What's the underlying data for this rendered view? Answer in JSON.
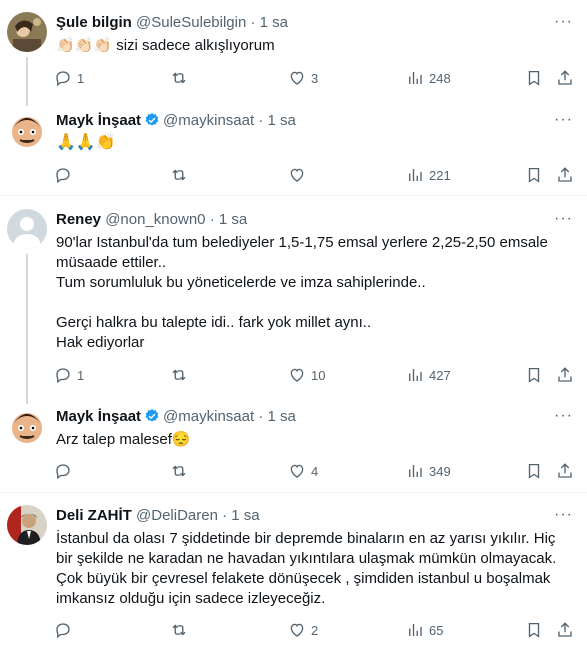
{
  "tweets": [
    {
      "name": "Şule bilgin",
      "handle": "@SuleSulebilgin",
      "time": "1 sa",
      "verified": false,
      "text": [
        "👏🏻👏🏻👏🏻 sizi sadece alkışlıyorum"
      ],
      "replies": "1",
      "retweets": "",
      "likes": "3",
      "views": "248"
    },
    {
      "name": "Mayk İnşaat",
      "handle": "@maykinsaat",
      "time": "1 sa",
      "verified": true,
      "text": [
        "🙏🙏👏"
      ],
      "replies": "",
      "retweets": "",
      "likes": "",
      "views": "221"
    },
    {
      "name": "Reney",
      "handle": "@non_known0",
      "time": "1 sa",
      "verified": false,
      "text": [
        "90'lar Istanbul'da tum belediyeler 1,5-1,75 emsal yerlere 2,25-2,50 emsale müsaade ettiler..",
        "Tum sorumluluk bu yöneticelerde ve imza sahiplerinde..",
        "",
        "Gerçi halkra bu talepte idi.. fark yok millet aynı..",
        "Hak ediyorlar"
      ],
      "replies": "1",
      "retweets": "",
      "likes": "10",
      "views": "427"
    },
    {
      "name": "Mayk İnşaat",
      "handle": "@maykinsaat",
      "time": "1 sa",
      "verified": true,
      "text": [
        "Arz talep malesef😔"
      ],
      "replies": "",
      "retweets": "",
      "likes": "4",
      "views": "349"
    },
    {
      "name": "Deli ZAHİT",
      "handle": "@DeliDaren",
      "time": "1 sa",
      "verified": false,
      "text": [
        "İstanbul da olası 7 şiddetinde bir depremde binaların en az yarısı yıkılır. Hiç bir şekilde ne karadan ne havadan yıkıntılara ulaşmak mümkün olmayacak. Çok büyük bir çevresel felakete dönüşecek , şimdiden istanbul u boşalmak imkansız olduğu için sadece izleyeceğiz."
      ],
      "replies": "",
      "retweets": "",
      "likes": "2",
      "views": "65"
    }
  ],
  "ui": {
    "dot": "·",
    "more": "···"
  },
  "colors": {
    "verified": "#1d9bf0",
    "secondary": "#536471",
    "divider": "#eff3f4",
    "thread": "#cfd9de"
  }
}
